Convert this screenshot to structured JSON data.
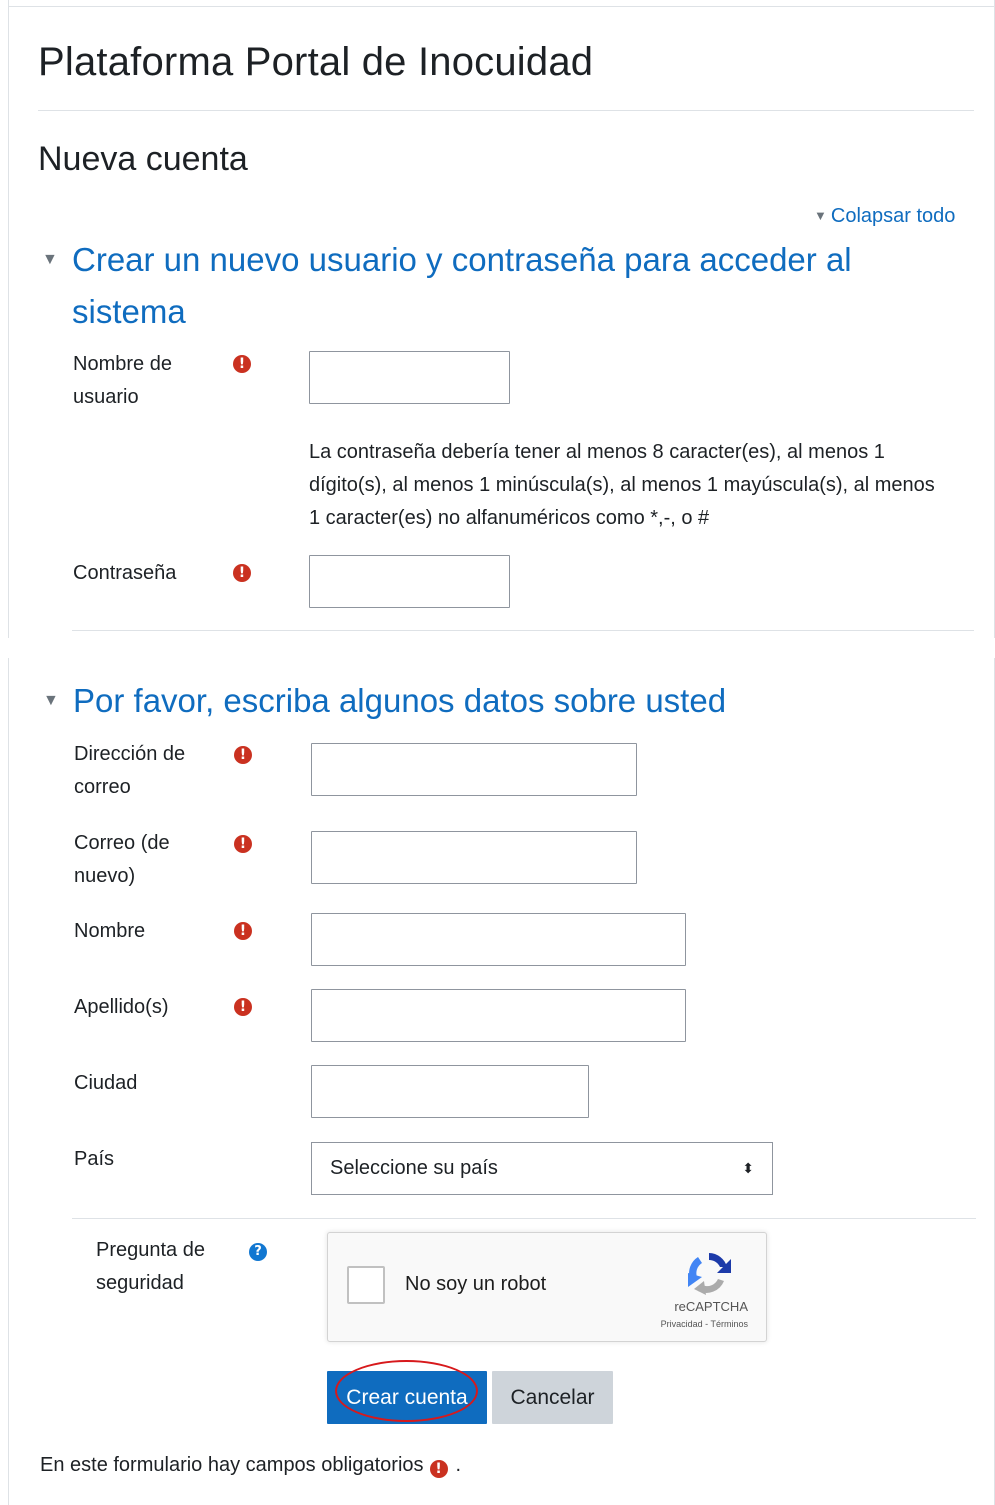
{
  "header": {
    "site_title": "Plataforma Portal de Inocuidad",
    "page_title": "Nueva cuenta"
  },
  "collapse_all": "Colapsar todo",
  "section1": {
    "title_line1": "Crear un nuevo usuario y contraseña para acceder al",
    "title_line2": "sistema",
    "username_label_1": "Nombre de",
    "username_label_2": "usuario",
    "password_hint_1": "La contraseña debería tener al menos 8 caracter(es), al menos 1",
    "password_hint_2": "dígito(s), al menos 1 minúscula(s), al menos 1 mayúscula(s), al menos",
    "password_hint_3": "1 caracter(es) no alfanuméricos como *,-, o #",
    "password_label": "Contraseña"
  },
  "section2": {
    "title": "Por favor, escriba algunos datos sobre usted",
    "email_label_1": "Dirección de",
    "email_label_2": "correo",
    "email2_label_1": "Correo (de",
    "email2_label_2": "nuevo)",
    "firstname_label": "Nombre",
    "lastname_label": "Apellido(s)",
    "city_label": "Ciudad",
    "country_label": "País",
    "country_selected": "Seleccione su país"
  },
  "security": {
    "label_1": "Pregunta de",
    "label_2": "seguridad",
    "captcha_text": "No soy un robot",
    "captcha_brand": "reCAPTCHA",
    "captcha_legal": "Privacidad - Términos"
  },
  "actions": {
    "create_label": "Crear cuenta",
    "cancel_label": "Cancelar"
  },
  "footer": {
    "note": "En este formulario hay campos obligatorios",
    "dot": "."
  },
  "icons": {
    "required": "exclamation-circle-icon",
    "help": "question-circle-icon",
    "collapse": "caret-down-icon"
  },
  "colors": {
    "link": "#0f6cbf",
    "required": "#ca3120",
    "primary_button": "#0f6cbf",
    "secondary_button": "#ced4da",
    "annotation": "#d7191c"
  }
}
